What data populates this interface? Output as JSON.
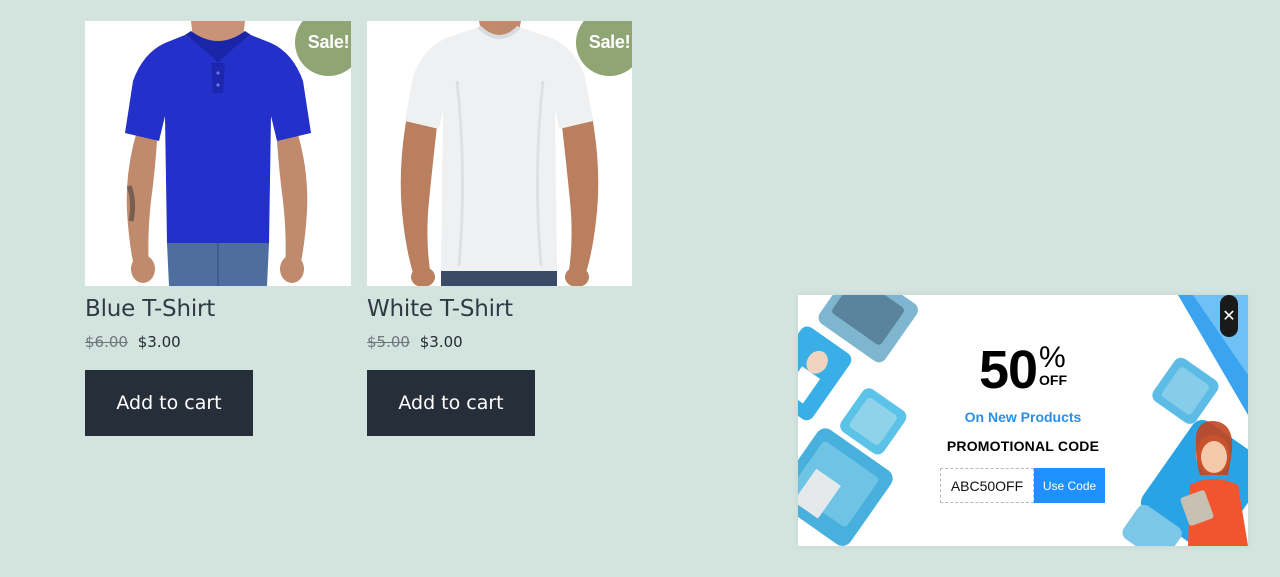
{
  "products": [
    {
      "title": "Blue T-Shirt",
      "badge": "Sale!",
      "old_price": "$6.00",
      "price": "$3.00",
      "button": "Add to cart",
      "shirt_color": "#2330c9"
    },
    {
      "title": "White T-Shirt",
      "badge": "Sale!",
      "old_price": "$5.00",
      "price": "$3.00",
      "button": "Add to cart",
      "shirt_color": "#f2f4f5"
    }
  ],
  "popup": {
    "close": "✕",
    "discount_number": "50",
    "discount_symbol": "%",
    "discount_off": "OFF",
    "subline": "On New Products",
    "promo_label": "PROMOTIONAL CODE",
    "code": "ABC50OFF",
    "use_code": "Use Code",
    "accent_color": "#1e90ff"
  }
}
